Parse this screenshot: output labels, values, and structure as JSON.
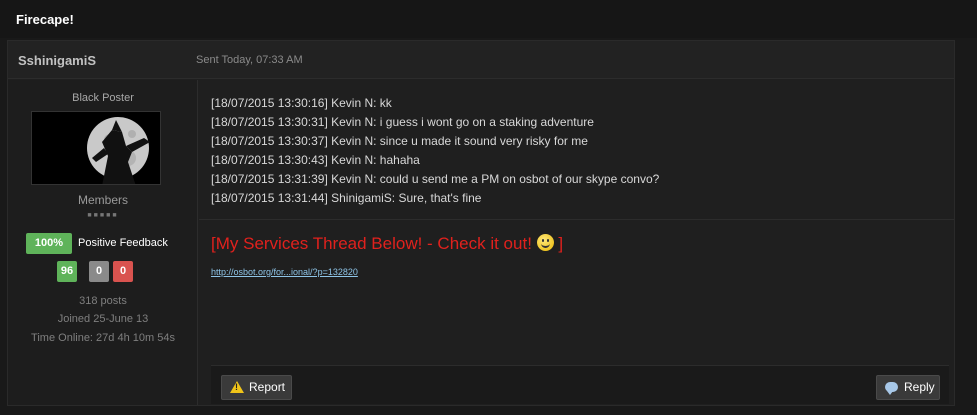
{
  "topic": {
    "title": "Firecape!"
  },
  "post": {
    "author": "SshinigamiS",
    "sent": "Sent Today, 07:33 AM",
    "sidebar": {
      "rank_title": "Black Poster",
      "group": "Members",
      "pips": "■■■■■",
      "feedback_percent": "100%",
      "feedback_label": "Positive Feedback",
      "rating_positive": "96",
      "rating_neutral": "0",
      "rating_negative": "0",
      "posts": "318 posts",
      "joined": "Joined 25-June 13",
      "time_online": "Time Online: 27d 4h 10m 54s"
    },
    "log": [
      "[18/07/2015 13:30:16] Kevin N: kk",
      "[18/07/2015 13:30:31] Kevin N: i guess i wont go on a staking adventure",
      "[18/07/2015 13:30:37] Kevin N: since u made it sound very risky for me",
      "[18/07/2015 13:30:43] Kevin N: hahaha",
      "[18/07/2015 13:31:39] Kevin N: could u send me a PM on osbot of our skype convo?",
      "[18/07/2015 13:31:44] ShinigamiS: Sure, that's fine"
    ],
    "signature": {
      "title_left": "[My Services Thread Below! - Check it out! ",
      "title_right": " ]",
      "link": "http://osbot.org/for...ional/?p=132820"
    },
    "actions": {
      "report_label": "Report",
      "reply_label": "Reply"
    }
  },
  "colors": {
    "accent_red": "#e0211d",
    "positive": "#5fb35a",
    "neutral": "#8a8a8a",
    "negative": "#d9534f",
    "link": "#8fc5e8"
  }
}
